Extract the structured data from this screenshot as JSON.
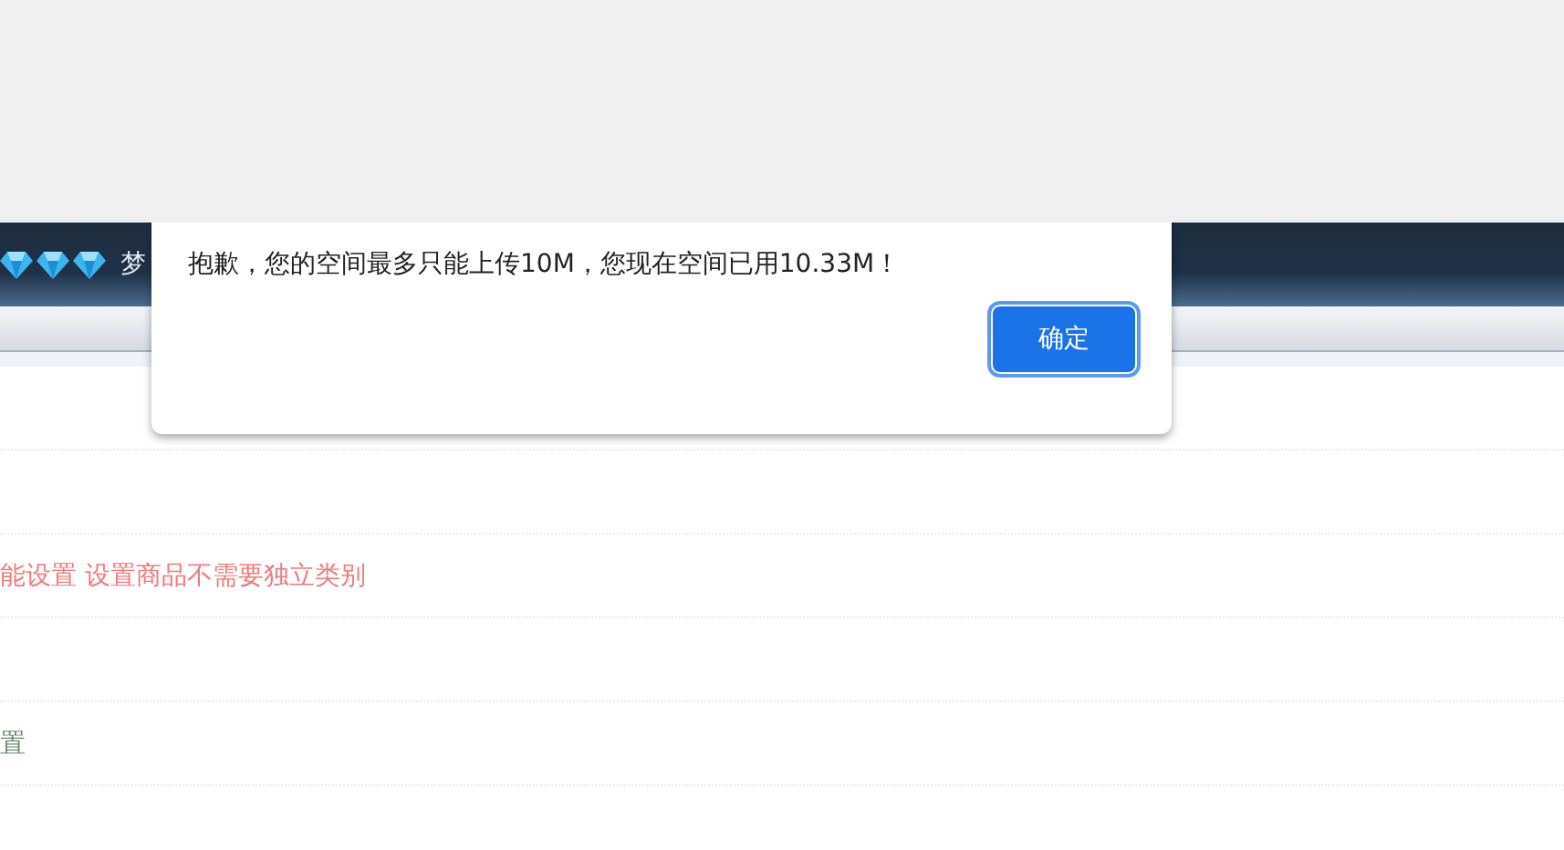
{
  "header": {
    "title": "梦"
  },
  "rows": [
    {
      "kind": "blank"
    },
    {
      "kind": "blank"
    },
    {
      "text": "能设置 设置商品不需要独立类别",
      "kind": "alert"
    },
    {
      "kind": "blank"
    },
    {
      "text": "置",
      "kind": "label"
    }
  ],
  "dialog": {
    "message": "抱歉，您的空间最多只能上传10M，您现在空间已用10.33M！",
    "button": "确定"
  }
}
